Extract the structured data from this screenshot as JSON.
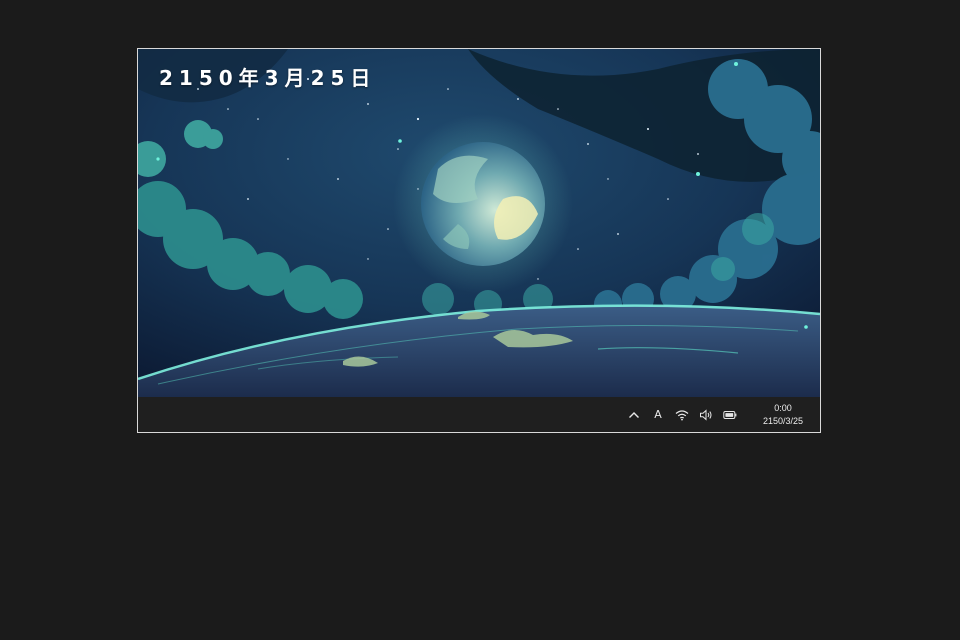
{
  "desktop": {
    "wallpaper_date_text": "2150年3月25日"
  },
  "taskbar": {
    "tray": {
      "overflow_icon": "chevron-up-icon",
      "ime_label": "A",
      "wifi_icon": "wifi-icon",
      "volume_icon": "volume-icon",
      "battery_icon": "battery-icon"
    },
    "clock": {
      "time": "0:00",
      "date": "2150/3/25"
    }
  },
  "colors": {
    "outer_background": "#1b1b1b",
    "taskbar": "#1f1f1f",
    "accent_teal": "#5de0c8"
  }
}
